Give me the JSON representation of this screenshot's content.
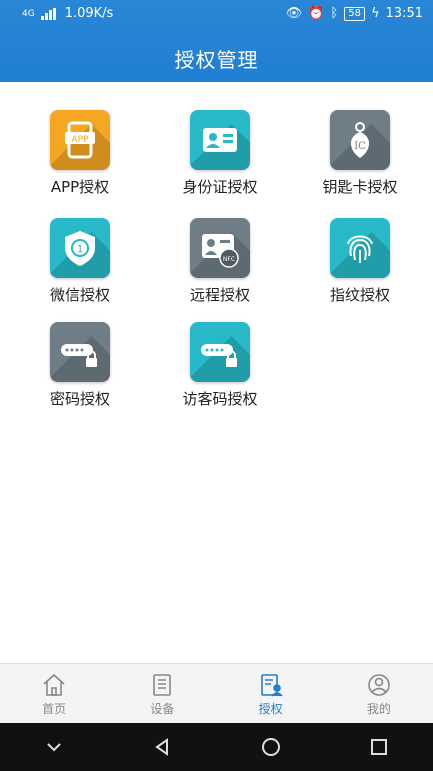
{
  "status": {
    "network": "4G",
    "speed": "1.09K/s",
    "battery": "58",
    "time": "13:51"
  },
  "header": {
    "title": "授权管理"
  },
  "items": [
    {
      "label": "APP授权",
      "icon": "app-icon"
    },
    {
      "label": "身份证授权",
      "icon": "id-card-icon"
    },
    {
      "label": "钥匙卡授权",
      "icon": "key-card-icon"
    },
    {
      "label": "微信授权",
      "icon": "wechat-shield-icon"
    },
    {
      "label": "远程授权",
      "icon": "remote-nfc-icon"
    },
    {
      "label": "指纹授权",
      "icon": "fingerprint-icon"
    },
    {
      "label": "密码授权",
      "icon": "password-lock-icon"
    },
    {
      "label": "访客码授权",
      "icon": "visitor-code-icon"
    }
  ],
  "app_icon_text": "APP",
  "ic_text": "IC",
  "nfc_text": "NFC",
  "bottom_nav": [
    {
      "label": "首页",
      "icon": "home-icon"
    },
    {
      "label": "设备",
      "icon": "device-icon"
    },
    {
      "label": "授权",
      "icon": "authorize-icon",
      "active": true
    },
    {
      "label": "我的",
      "icon": "profile-icon"
    }
  ],
  "colors": {
    "primary": "#1f7fd3",
    "orange": "#f5a623",
    "teal": "#27b9c7",
    "gray": "#6f7d86"
  }
}
